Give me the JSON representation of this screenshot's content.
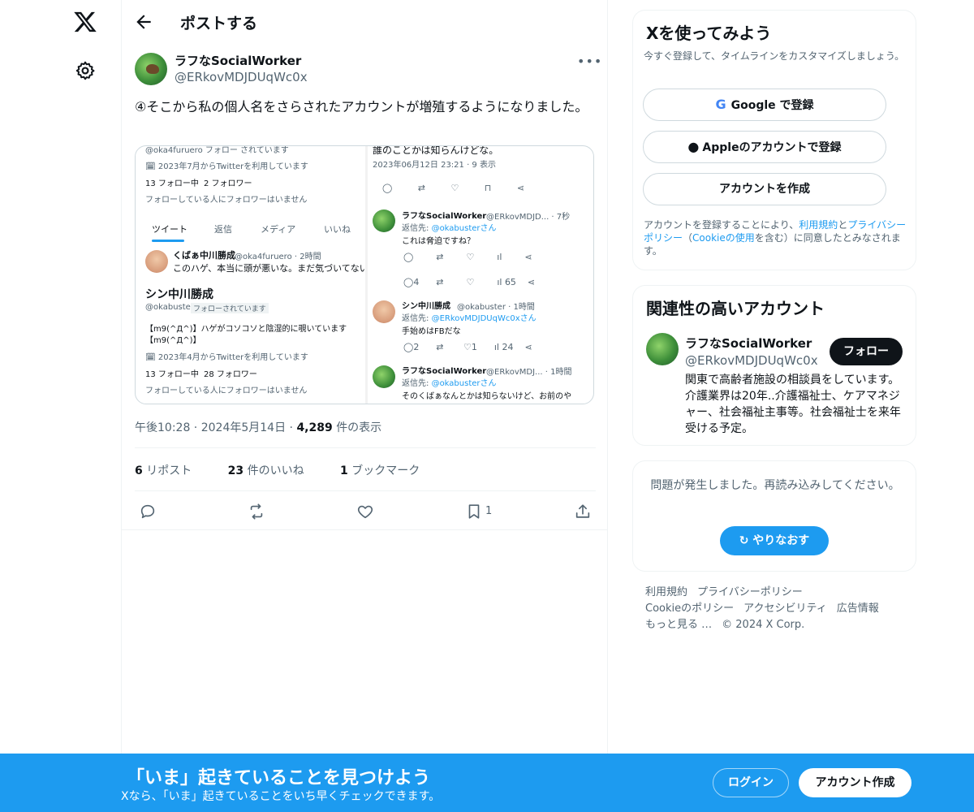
{
  "header": {
    "title": "ポストする"
  },
  "post": {
    "author_name": "ラフなSocialWorker",
    "author_handle": "@ERkovMDJDUqWc0x",
    "text": "④そこから私の個人名をさらされたアカウントが増殖するようになりました。",
    "time": "午後10:28",
    "date": "2024年5月14日",
    "views": "4,289",
    "views_label": "件の表示",
    "reposts": "6",
    "reposts_label": "リポスト",
    "likes": "23",
    "likes_label": "件のいいね",
    "bookmarks": "1",
    "bookmarks_label": "ブックマーク",
    "bookmark_count": "1"
  },
  "media": {
    "left": {
      "top_cut": "@oka4furuero フォロー されています",
      "joined1": "2023年7月からTwitterを利用しています",
      "following1": "13 フォロー中",
      "followers1": "2 フォロワー",
      "no_mutual1": "フォローしている人にフォロワーはいません",
      "tabs": [
        "ツイート",
        "返信",
        "メディア",
        "いいね"
      ],
      "tweet_name": "くばぁ中川勝成",
      "tweet_handle": "@oka4furuero · 2時間",
      "tweet_text": "このハゲ、本当に頭が悪いな。まだ気づいてない",
      "profile_name": "シン中川勝成",
      "profile_handle": "@okabuster",
      "profile_badge": "フォローされています",
      "bio1": "【m9(^Д^)】ハゲがコソコソと陰湿的に覗いています",
      "bio2": "【m9(^Д^)】",
      "joined2": "2023年4月からTwitterを利用しています",
      "following2": "13 フォロー中",
      "followers2": "28 フォロワー",
      "no_mutual2": "フォローしている人にフォロワーはいません"
    },
    "right": {
      "top_text": "誰のことかは知らんけどな。",
      "top_time": "2023年06月12日 23:21 · 9 表示",
      "r1_name": "ラフなSocialWorker",
      "r1_handle": "@ERkovMDJD... · 7秒",
      "r1_reply_prefix": "返信先:",
      "r1_reply_to": "@okabusterさん",
      "r1_text": "これは脅迫ですね？",
      "r1_stat_reply": "4",
      "r1_stat_views": "65",
      "r2_name": "シン中川勝成",
      "r2_handle": "@okabuster · 1時間",
      "r2_reply_prefix": "返信先:",
      "r2_reply_to": "@ERkovMDJDUqWc0xさん",
      "r2_text": "手始めはFBだな",
      "r2_stat_reply": "2",
      "r2_stat_like": "1",
      "r2_stat_views": "24",
      "r3_name": "ラフなSocialWorker",
      "r3_handle": "@ERkovMDJ... · 1時間",
      "r3_reply_prefix": "返信先:",
      "r3_reply_to": "@okabusterさん",
      "r3_text": "そのくばぁなんとかは知らないけど、お前のや"
    }
  },
  "signup_card": {
    "title": "Xを使ってみよう",
    "subtitle": "今すぐ登録して、タイムラインをカスタマイズしましょう。",
    "google": "Google で登録",
    "apple": "Appleのアカウントで登録",
    "create": "アカウントを作成",
    "legal_pre": "アカウントを登録することにより、",
    "legal_terms": "利用規約",
    "legal_and": "と",
    "legal_privacy": "プライバシーポリシー",
    "legal_mid": "（",
    "legal_cookie": "Cookieの使用",
    "legal_post": "を含む）に同意したとみなされます。"
  },
  "related": {
    "title": "関連性の高いアカウント",
    "name": "ラフなSocialWorker",
    "handle": "@ERkovMDJDUqWc0x",
    "follow": "フォロー",
    "bio": "関東で高齢者施設の相談員をしています。 介護業界は20年..介護福祉士、ケアマネジャー、社会福祉主事等。社会福祉士を来年受ける予定。"
  },
  "error_card": {
    "text": "問題が発生しました。再読み込みしてください。",
    "retry": "やりなおす"
  },
  "footer": {
    "terms": "利用規約",
    "privacy": "プライバシーポリシー",
    "cookie": "Cookieのポリシー",
    "accessibility": "アクセシビリティ",
    "ads": "広告情報",
    "more": "もっと見る …",
    "copyright": "© 2024 X Corp."
  },
  "bottom_bar": {
    "title": "「いま」起きていることを見つけよう",
    "subtitle": "Xなら、「いま」起きていることをいち早くチェックできます。",
    "login": "ログイン",
    "signup": "アカウント作成"
  },
  "colors": {
    "accent": "#1d9bf0",
    "text": "#0f1419",
    "muted": "#536471"
  }
}
